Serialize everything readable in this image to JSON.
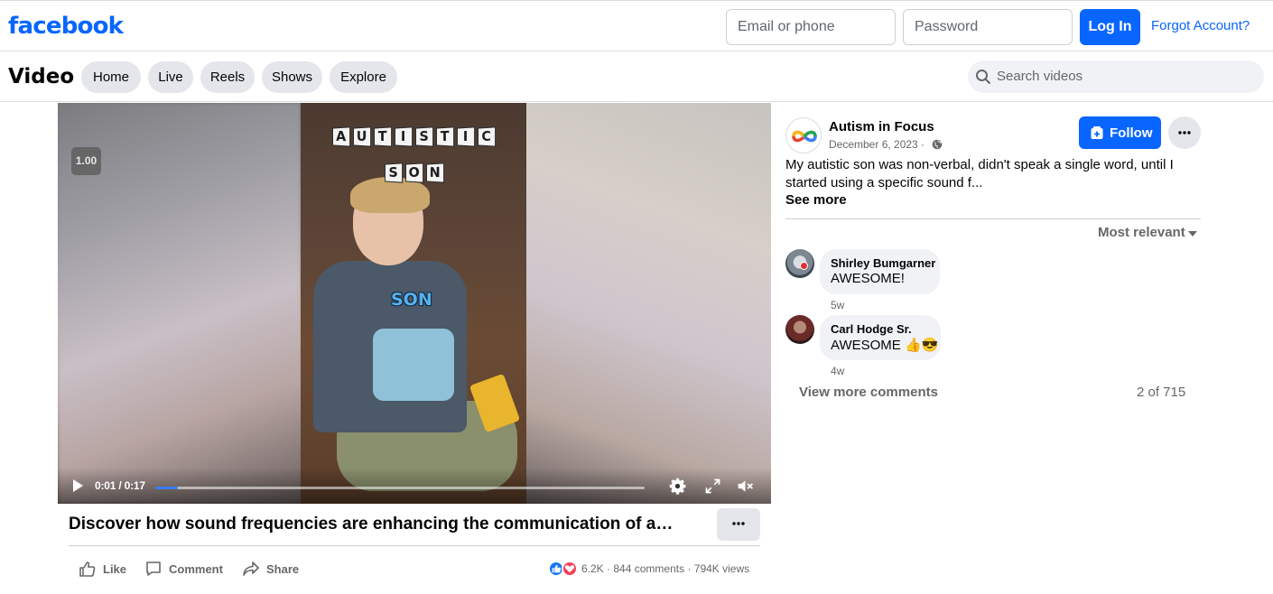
{
  "header": {
    "logo": "facebook",
    "email_placeholder": "Email or phone",
    "password_placeholder": "Password",
    "login_label": "Log In",
    "forgot_label": "Forgot Account?"
  },
  "nav": {
    "title": "Video",
    "tabs": [
      {
        "label": "Home"
      },
      {
        "label": "Live"
      },
      {
        "label": "Reels"
      },
      {
        "label": "Shows"
      },
      {
        "label": "Explore"
      }
    ],
    "search_placeholder": "Search videos"
  },
  "video": {
    "overlay_word_1": [
      "A",
      "U",
      "T",
      "I",
      "S",
      "T",
      "I",
      "C"
    ],
    "overlay_word_2": [
      "S",
      "O",
      "N"
    ],
    "shirt_label": "SON",
    "speed": "1.00",
    "time": "0:01 / 0:17",
    "progress": 0.046
  },
  "post": {
    "title": "Discover how sound frequencies are enhancing the communication of a…",
    "actions": {
      "like": "Like",
      "comment": "Comment",
      "share": "Share"
    },
    "reaction_count": "6.2K",
    "comments_count": "844 comments",
    "views": "794K views",
    "separator": "·"
  },
  "page": {
    "name": "Autism in Focus",
    "date": "December 6, 2023 ·",
    "follow_label": "Follow",
    "description": "My autistic son was non-verbal, didn't speak a single word, until I started using a specific sound f...",
    "see_more": "See more",
    "sort_label": "Most relevant"
  },
  "comments": [
    {
      "author": "Shirley Bumgarner",
      "text": "AWESOME!",
      "time": "5w"
    },
    {
      "author": "Carl Hodge Sr.",
      "text": "AWESOME 👍😎",
      "time": "4w"
    }
  ],
  "comments_footer": {
    "view_more": "View more comments",
    "count": "2 of 715"
  },
  "colors": {
    "brand_blue": "#0866ff",
    "progress_blue": "#3a7bf4",
    "secondary_text": "#65676b"
  }
}
